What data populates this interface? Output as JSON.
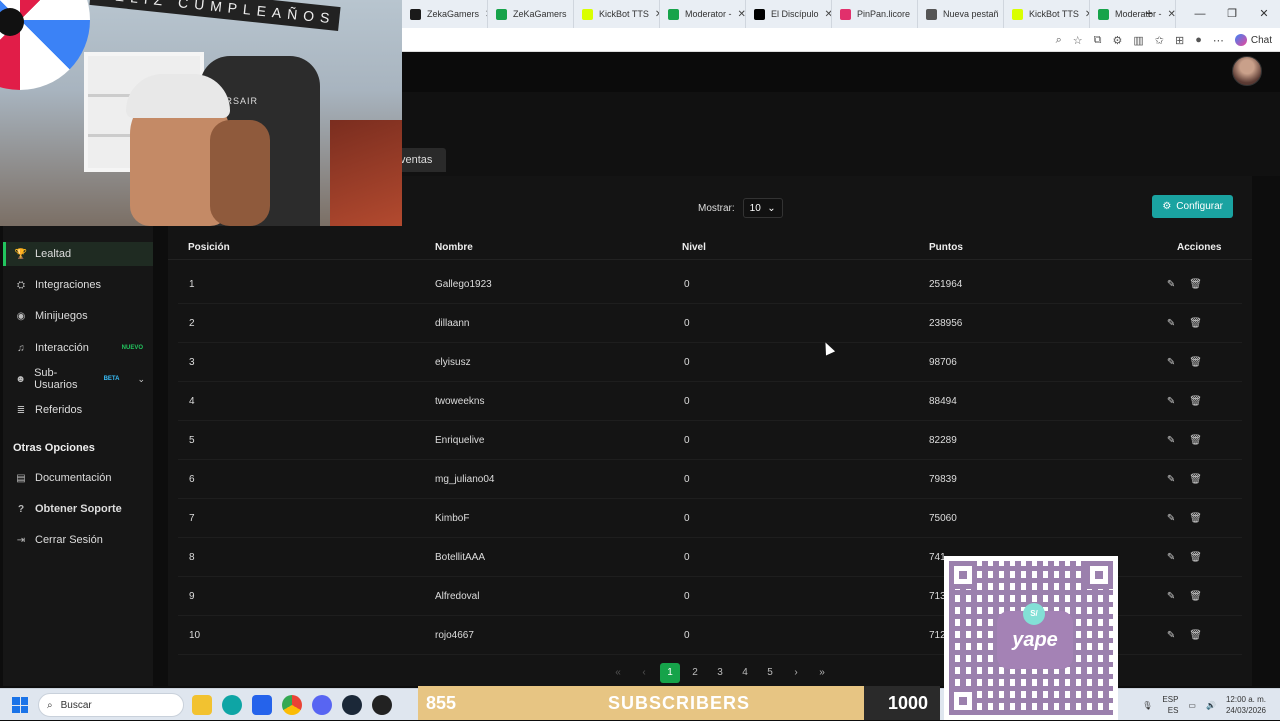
{
  "browser": {
    "tabs": [
      {
        "label": "ZekaGamers",
        "color": "#1a1a1a"
      },
      {
        "label": "ZeKaGamers",
        "color": "#16a34a"
      },
      {
        "label": "KickBot TTS",
        "color": "#d9ff00"
      },
      {
        "label": "Moderator -",
        "color": "#16a34a"
      },
      {
        "label": "El Discípulo",
        "color": "#000000"
      },
      {
        "label": "PinPan.licore",
        "color": "#e1306c"
      },
      {
        "label": "Nueva pestañ",
        "color": "#555555"
      },
      {
        "label": "KickBot TTS",
        "color": "#d9ff00"
      },
      {
        "label": "Moderator -",
        "color": "#16a34a"
      }
    ],
    "new_tab": "+",
    "chat_label": "Chat"
  },
  "page": {
    "section_tab": "ventas"
  },
  "sidebar": {
    "items": [
      {
        "label": "Lealtad",
        "icon": "trophy-icon",
        "glyph": "🏆",
        "active": true
      },
      {
        "label": "Integraciones",
        "icon": "puzzle-icon",
        "glyph": "⛭"
      },
      {
        "label": "Minijuegos",
        "icon": "gamepad-icon",
        "glyph": "◉"
      },
      {
        "label": "Interacción",
        "icon": "music-icon",
        "glyph": "♫",
        "badge": "NUEVO"
      },
      {
        "label": "Sub-Usuarios",
        "icon": "users-icon",
        "glyph": "☻",
        "badge": "BETA",
        "chevron": "⌄"
      },
      {
        "label": "Referidos",
        "icon": "list-icon",
        "glyph": "≣"
      }
    ],
    "other_heading": "Otras Opciones",
    "other_items": [
      {
        "label": "Documentación",
        "icon": "doc-icon",
        "glyph": "▤"
      },
      {
        "label": "Obtener Soporte",
        "icon": "help-icon",
        "glyph": "?"
      },
      {
        "label": "Cerrar Sesión",
        "icon": "logout-icon",
        "glyph": "⇥"
      }
    ]
  },
  "controls": {
    "show_label": "Mostrar:",
    "show_value": "10",
    "config_label": "Configurar"
  },
  "table": {
    "headers": [
      "Posición",
      "Nombre",
      "Nivel",
      "Puntos",
      "Acciones"
    ],
    "rows": [
      {
        "pos": "1",
        "name": "Gallego1923",
        "level": "0",
        "points": "251964"
      },
      {
        "pos": "2",
        "name": "dillaann",
        "level": "0",
        "points": "238956"
      },
      {
        "pos": "3",
        "name": "elyisusz",
        "level": "0",
        "points": "98706"
      },
      {
        "pos": "4",
        "name": "twoweekns",
        "level": "0",
        "points": "88494"
      },
      {
        "pos": "5",
        "name": "Enriquelive",
        "level": "0",
        "points": "82289"
      },
      {
        "pos": "6",
        "name": "mg_juliano04",
        "level": "0",
        "points": "79839"
      },
      {
        "pos": "7",
        "name": "KimboF",
        "level": "0",
        "points": "75060"
      },
      {
        "pos": "8",
        "name": "BotellitAAA",
        "level": "0",
        "points": "741"
      },
      {
        "pos": "9",
        "name": "Alfredoval",
        "level": "0",
        "points": "713"
      },
      {
        "pos": "10",
        "name": "rojo4667",
        "level": "0",
        "points": "712"
      }
    ]
  },
  "pagination": {
    "first": "«",
    "prev": "‹",
    "pages": [
      "1",
      "2",
      "3",
      "4",
      "5"
    ],
    "current": "1",
    "next": "›",
    "last": "»"
  },
  "overlay": {
    "banner_text": "FELIZ CUMPLEAÑOS",
    "chair_text": "CORSAIR",
    "subscribers_current": "855",
    "subscribers_label": "SUBSCRIBERS",
    "subscribers_goal": "1000",
    "subscribers_progress": 0.855,
    "qr_brand": "yape",
    "qr_badge": "S/"
  },
  "taskbar": {
    "search_placeholder": "Buscar",
    "lang_top": "ESP",
    "lang_bottom": "ES",
    "time": "12:00 a. m.",
    "date": "24/03/2026"
  }
}
